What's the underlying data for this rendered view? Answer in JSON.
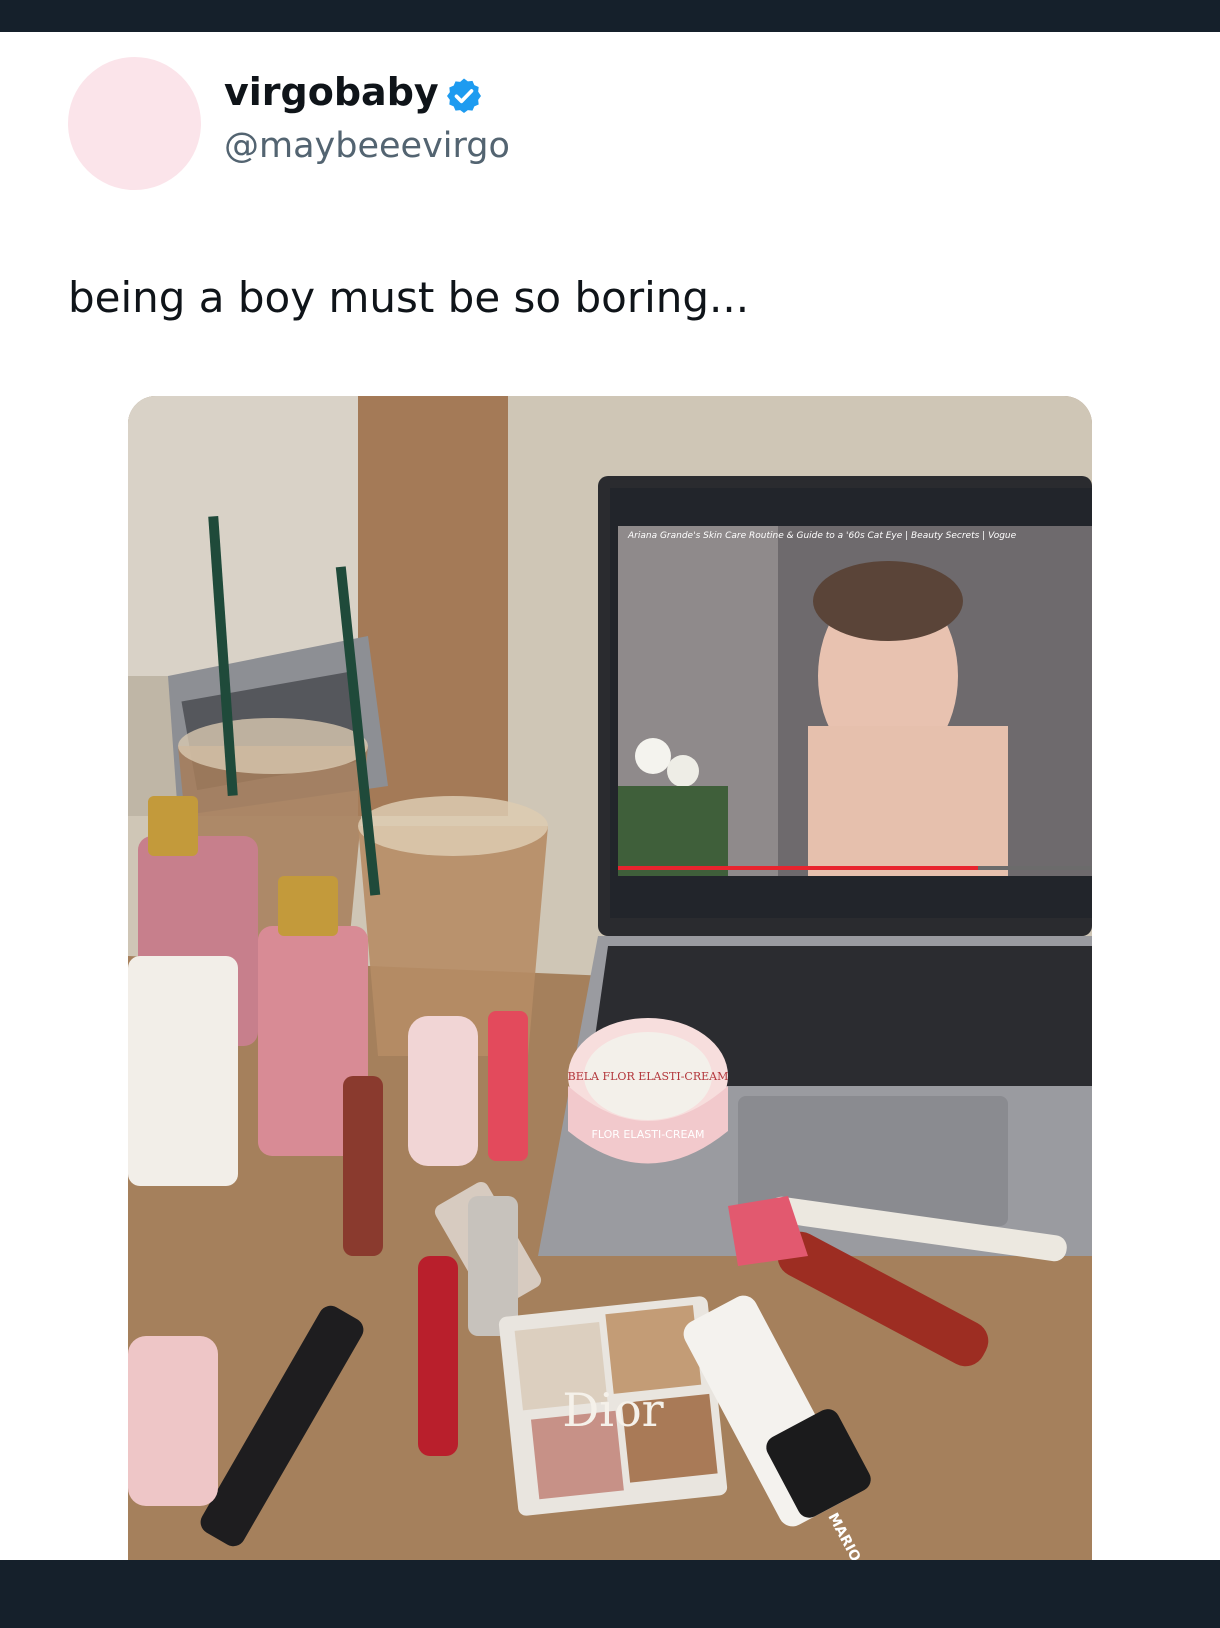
{
  "tweet": {
    "display_name": "virgobaby",
    "handle": "@maybeeevirgo",
    "text": "being a boy must be so boring...",
    "verified_icon": "verified-badge-icon"
  },
  "media": {
    "screen_caption": "Ariana Grande's Skin Care Routine & Guide to a '60s Cat Eye | Beauty Secrets | Vogue",
    "cream_jar_label": "BELA FLOR ELASTI-CREAM",
    "cream_jar_rim": "FLOR ELASTI-CREAM",
    "palette_brand": "Dior",
    "lipstick_brand": "MARIO"
  },
  "colors": {
    "verified_blue": "#1d9bf0",
    "avatar_pink": "#fbe4ea",
    "text_primary": "#0f1419",
    "text_secondary": "#536471",
    "frame_dark": "#15202b"
  }
}
